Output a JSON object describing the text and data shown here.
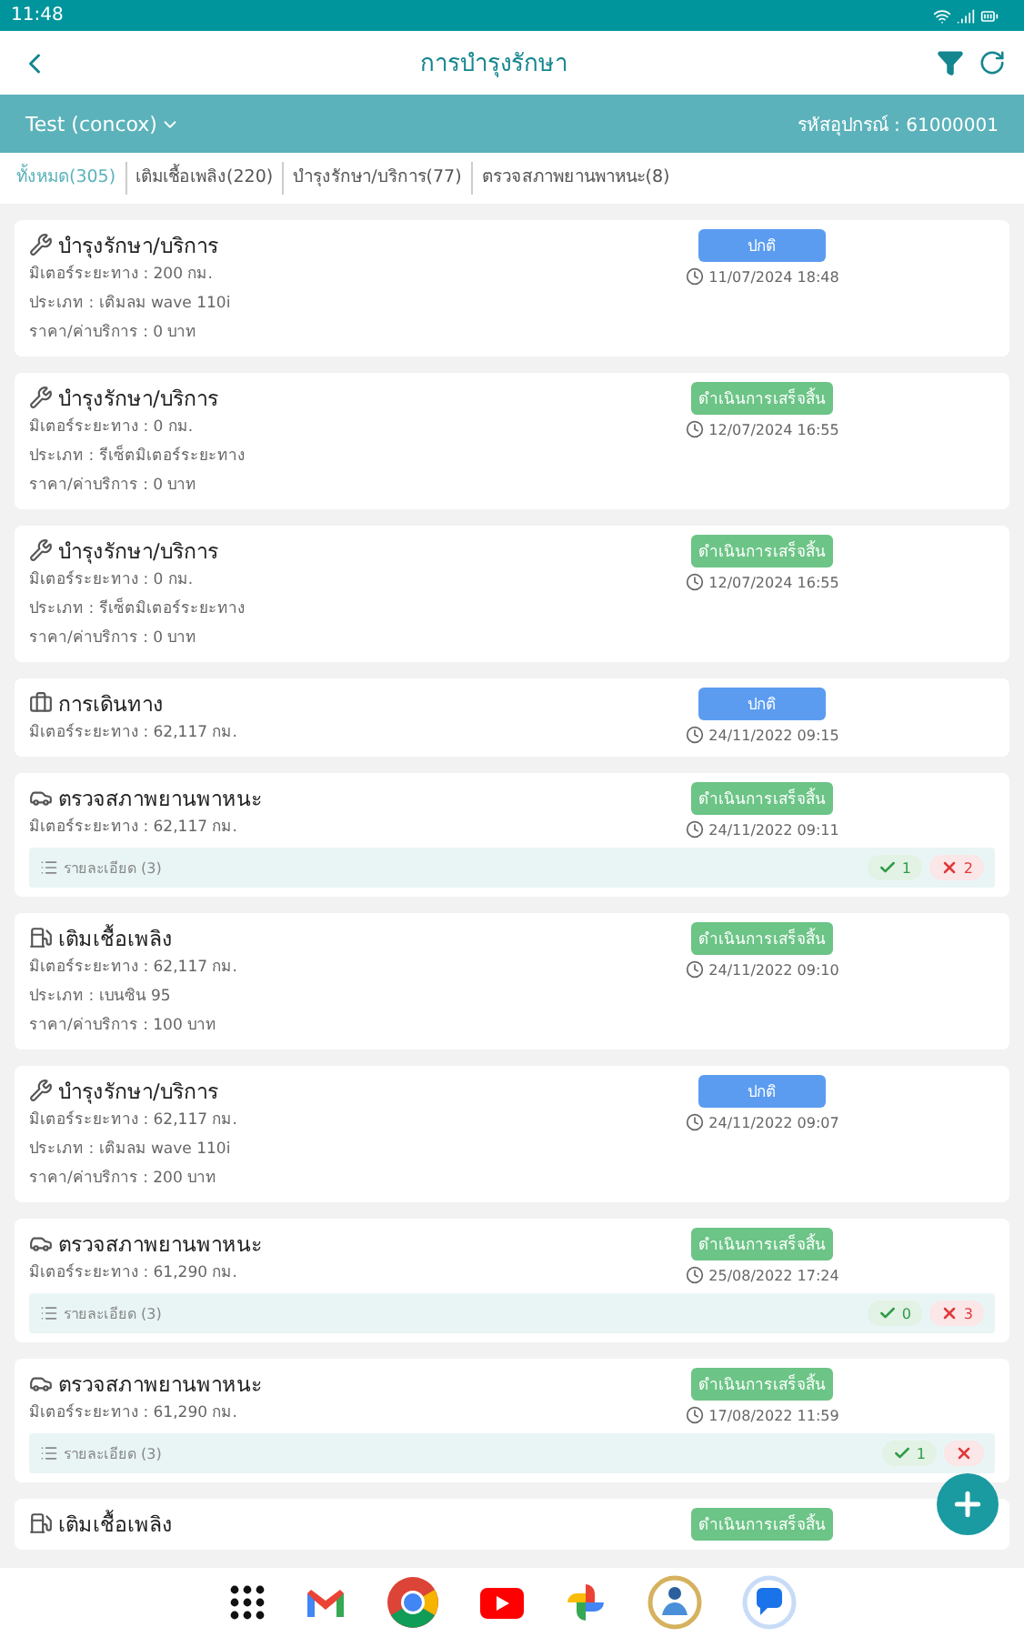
{
  "status_bar": {
    "time": "11:48"
  },
  "header": {
    "title": "การบำรุงรักษา"
  },
  "vehicle_bar": {
    "vehicle": "Test (concox)",
    "device_code": "รหัสอุปกรณ์ : 61000001"
  },
  "tabs": [
    {
      "label": "ทั้งหมด(305)",
      "selected": true
    },
    {
      "label": "เติมเชื้อเพลิง(220)",
      "selected": false
    },
    {
      "label": "บำรุงรักษา/บริการ(77)",
      "selected": false
    },
    {
      "label": "ตรวจสภาพยานพาหนะ(8)",
      "selected": false
    }
  ],
  "records": [
    {
      "kind": "service",
      "title": "บำรุงรักษา/บริการ",
      "lines": [
        "มิเตอร์ระยะทาง : 200 กม.",
        "ประเภท : เติมลม wave 110i",
        "ราคา/ค่าบริการ : 0 บาท"
      ],
      "status": {
        "label": "ปกติ",
        "color": "#5b9cf0"
      },
      "datetime": "11/07/2024 18:48"
    },
    {
      "kind": "service",
      "title": "บำรุงรักษา/บริการ",
      "lines": [
        "มิเตอร์ระยะทาง : 0 กม.",
        "ประเภท : รีเซ็ตมิเตอร์ระยะทาง",
        "ราคา/ค่าบริการ : 0 บาท"
      ],
      "status": {
        "label": "ดำเนินการเสร็จสิ้น",
        "color": "#6cc486"
      },
      "datetime": "12/07/2024 16:55"
    },
    {
      "kind": "service",
      "title": "บำรุงรักษา/บริการ",
      "lines": [
        "มิเตอร์ระยะทาง : 0 กม.",
        "ประเภท : รีเซ็ตมิเตอร์ระยะทาง",
        "ราคา/ค่าบริการ : 0 บาท"
      ],
      "status": {
        "label": "ดำเนินการเสร็จสิ้น",
        "color": "#6cc486"
      },
      "datetime": "12/07/2024 16:55"
    },
    {
      "kind": "trip",
      "title": "การเดินทาง",
      "lines": [
        "มิเตอร์ระยะทาง : 62,117 กม."
      ],
      "status": {
        "label": "ปกติ",
        "color": "#5b9cf0"
      },
      "datetime": "24/11/2022 09:15"
    },
    {
      "kind": "inspection",
      "title": "ตรวจสภาพยานพาหนะ",
      "lines": [
        "มิเตอร์ระยะทาง : 62,117 กม."
      ],
      "status": {
        "label": "ดำเนินการเสร็จสิ้น",
        "color": "#6cc486"
      },
      "datetime": "24/11/2022 09:11",
      "details": {
        "label": "รายละเอียด (3)",
        "pass": "1",
        "fail": "2"
      }
    },
    {
      "kind": "fuel",
      "title": "เติมเชื้อเพลิง",
      "lines": [
        "มิเตอร์ระยะทาง : 62,117 กม.",
        "ประเภท : เบนซิน 95",
        "ราคา/ค่าบริการ : 100 บาท"
      ],
      "status": {
        "label": "ดำเนินการเสร็จสิ้น",
        "color": "#6cc486"
      },
      "datetime": "24/11/2022 09:10"
    },
    {
      "kind": "service",
      "title": "บำรุงรักษา/บริการ",
      "lines": [
        "มิเตอร์ระยะทาง : 62,117 กม.",
        "ประเภท : เติมลม wave 110i",
        "ราคา/ค่าบริการ : 200 บาท"
      ],
      "status": {
        "label": "ปกติ",
        "color": "#5b9cf0"
      },
      "datetime": "24/11/2022 09:07"
    },
    {
      "kind": "inspection",
      "title": "ตรวจสภาพยานพาหนะ",
      "lines": [
        "มิเตอร์ระยะทาง : 61,290 กม."
      ],
      "status": {
        "label": "ดำเนินการเสร็จสิ้น",
        "color": "#6cc486"
      },
      "datetime": "25/08/2022 17:24",
      "details": {
        "label": "รายละเอียด (3)",
        "pass": "0",
        "fail": "3"
      }
    },
    {
      "kind": "inspection",
      "title": "ตรวจสภาพยานพาหนะ",
      "lines": [
        "มิเตอร์ระยะทาง : 61,290 กม."
      ],
      "status": {
        "label": "ดำเนินการเสร็จสิ้น",
        "color": "#6cc486"
      },
      "datetime": "17/08/2022 11:59",
      "details": {
        "label": "รายละเอียด (3)",
        "pass": "1"
      }
    },
    {
      "kind": "fuel",
      "title": "เติมเชื้อเพลิง",
      "status": {
        "label": "ดำเนินการเสร็จสิ้น",
        "color": "#6cc486"
      }
    }
  ]
}
